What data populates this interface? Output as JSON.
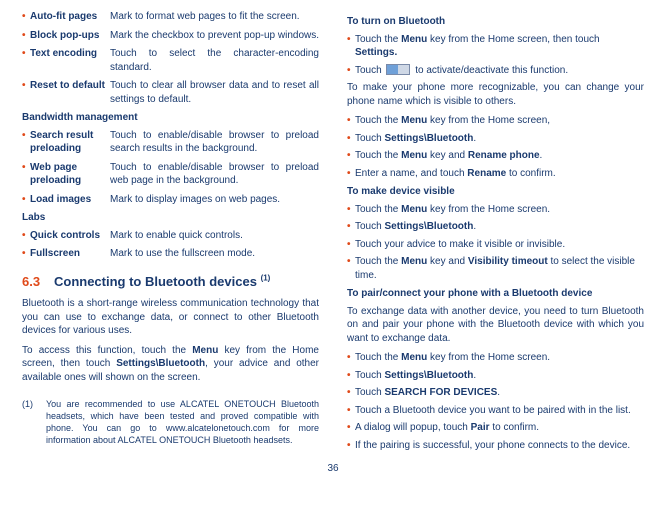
{
  "left": {
    "rows1": [
      {
        "label": "Auto-fit pages",
        "desc": "Mark to format web pages to fit the screen."
      },
      {
        "label": "Block pop-ups",
        "desc": "Mark the checkbox to prevent pop-up windows."
      },
      {
        "label": "Text encoding",
        "desc": "Touch to select the character-encoding standard."
      },
      {
        "label": "Reset to default",
        "desc": "Touch to clear all browser data and to reset all settings to default."
      }
    ],
    "bw_heading": "Bandwidth management",
    "rows2": [
      {
        "label": "Search result preloading",
        "desc": "Touch to enable/disable browser to preload search results in the background."
      },
      {
        "label": "Web page preloading",
        "desc": "Touch to enable/disable browser to preload web page in the background."
      },
      {
        "label": "Load images",
        "desc": "Mark to display images on web pages."
      }
    ],
    "labs_heading": "Labs",
    "rows3": [
      {
        "label": "Quick controls",
        "desc": "Mark to enable quick controls."
      },
      {
        "label": "Fullscreen",
        "desc": "Mark to use the fullscreen mode."
      }
    ],
    "sec_num": "6.3",
    "sec_title": "Connecting to Bluetooth devices ",
    "sec_sup": "(1)",
    "para1": "Bluetooth is a short-range wireless communication technology that you can use to exchange data, or connect to other Bluetooth devices for various uses.",
    "para2a": "To access this function, touch the ",
    "para2b": "Menu",
    "para2c": " key from the Home screen, then touch ",
    "para2d": "Settings\\Bluetooth",
    "para2e": ", your advice and other available ones will shown on the screen.",
    "fn_mark": "(1)",
    "fn_body": "You are recommended to use ALCATEL ONETOUCH Bluetooth headsets, which have been tested and proved compatible with phone. You can go to www.alcatelonetouch.com for more information about ALCATEL ONETOUCH Bluetooth headsets."
  },
  "right": {
    "h1": "To turn on Bluetooth",
    "r1a": "Touch the ",
    "r1b": "Menu",
    "r1c": " key from the Home screen, then touch ",
    "r1d": "Settings.",
    "r2a": "Touch ",
    "r2b": " to activate/deactivate this function.",
    "p1": "To make your phone more recognizable, you can change your phone name which is visible to others.",
    "r3a": "Touch the ",
    "r3b": "Menu",
    "r3c": " key from the Home screen,",
    "r4a": "Touch ",
    "r4b": "Settings\\Bluetooth",
    "r4c": ".",
    "r5a": "Touch the ",
    "r5b": "Menu",
    "r5c": " key and ",
    "r5d": "Rename phone",
    "r5e": ".",
    "r6a": "Enter a name, and touch ",
    "r6b": "Rename",
    "r6c": " to confirm.",
    "h2": "To make device visible",
    "r7a": "Touch the ",
    "r7b": "Menu",
    "r7c": " key from the Home screen.",
    "r8a": "Touch ",
    "r8b": "Settings\\Bluetooth",
    "r8c": ".",
    "r9": "Touch your advice to make it visible or invisible.",
    "r10a": "Touch the ",
    "r10b": "Menu",
    "r10c": " key and ",
    "r10d": "Visibility timeout",
    "r10e": " to select the visible time.",
    "h3": "To pair/connect your phone with a Bluetooth device",
    "p2": "To exchange data with another device, you need to turn Bluetooth on and pair your phone with the Bluetooth device with which you want to exchange data.",
    "r11a": "Touch the ",
    "r11b": "Menu",
    "r11c": " key from the Home screen.",
    "r12a": "Touch ",
    "r12b": "Settings\\Bluetooth",
    "r12c": ".",
    "r13a": "Touch ",
    "r13b": "SEARCH FOR DEVICES",
    "r13c": ".",
    "r14": "Touch a Bluetooth device you want to be paired with in the list.",
    "r15a": "A dialog will popup, touch ",
    "r15b": "Pair",
    "r15c": " to confirm.",
    "r16": "If the pairing is successful, your phone connects to the device."
  },
  "page_number": "36"
}
